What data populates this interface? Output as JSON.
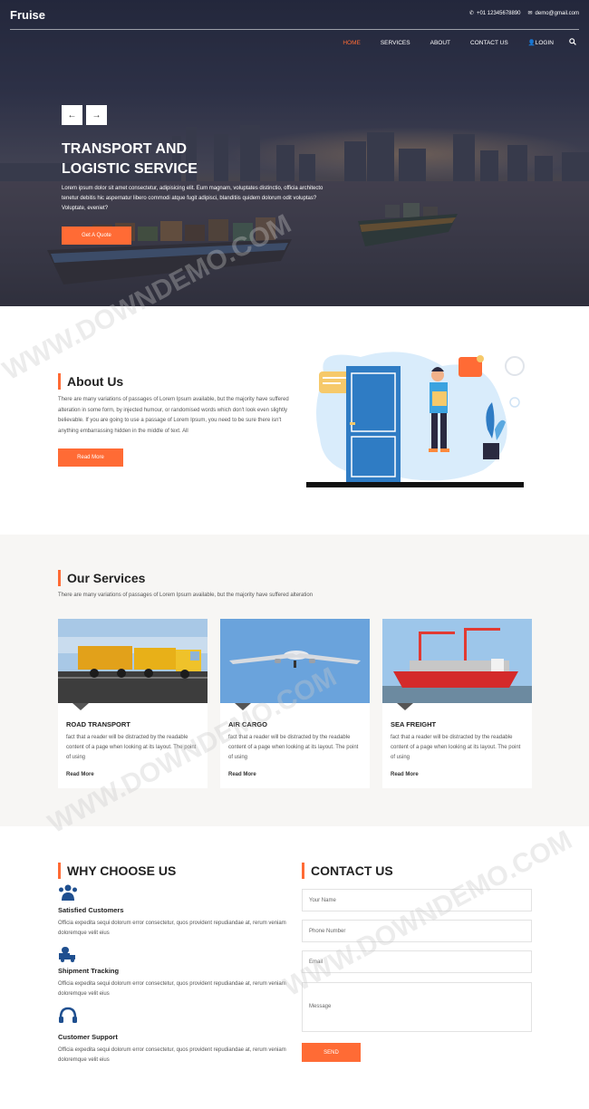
{
  "header": {
    "brand": "Fruise",
    "phone": "+01 12345678890",
    "email": "demo@gmail.com",
    "nav": [
      {
        "label": "HOME",
        "active": true
      },
      {
        "label": "SERVICES",
        "active": false
      },
      {
        "label": "ABOUT",
        "active": false
      },
      {
        "label": "CONTACT US",
        "active": false
      },
      {
        "label": "LOGIN",
        "active": false
      }
    ]
  },
  "hero": {
    "prev_arrow": "←",
    "next_arrow": "→",
    "title_line1": "TRANSPORT AND",
    "title_line2": "LOGISTIC SERVICE",
    "text": "Lorem ipsum dolor sit amet consectetur, adipisicing elit. Eum magnam, voluptates distinctio, officia architecto tenetur debitis hic aspernatur libero commodi atque fugit adipisci, blanditiis quidem dolorum odit voluptas? Voluptate, eveniet?",
    "button": "Get A Quote"
  },
  "about": {
    "title": "About Us",
    "text": "There are many variations of passages of Lorem Ipsum available, but the majority have suffered alteration in some form, by injected humour, or randomised words which don't look even slightly believable. If you are going to use a passage of Lorem Ipsum, you need to be sure there isn't anything embarrassing hidden in the middle of text. All",
    "button": "Read More"
  },
  "services": {
    "title": "Our Services",
    "subtitle": "There are many variations of passages of Lorem Ipsum available, but the majority have suffered alteration",
    "cards": [
      {
        "title": "ROAD TRANSPORT",
        "text": "fact that a reader will be distracted by the readable content of a page when looking at its layout. The point of using",
        "link": "Read More"
      },
      {
        "title": "AIR CARGO",
        "text": "fact that a reader will be distracted by the readable content of a page when looking at its layout. The point of using",
        "link": "Read More"
      },
      {
        "title": "SEA FREIGHT",
        "text": "fact that a reader will be distracted by the readable content of a page when looking at its layout. The point of using",
        "link": "Read More"
      }
    ]
  },
  "why": {
    "title": "WHY CHOOSE US",
    "items": [
      {
        "title": "Satisfied Customers",
        "text": "Officia expedita sequi dolorum error consectetur, quos provident repudiandae at, rerum veniam doloremque velit eius"
      },
      {
        "title": "Shipment Tracking",
        "text": "Officia expedita sequi dolorum error consectetur, quos provident repudiandae at, rerum veniam doloremque velit eius"
      },
      {
        "title": "Customer Support",
        "text": "Officia expedita sequi dolorum error consectetur, quos provident repudiandae at, rerum veniam doloremque velit eius"
      }
    ]
  },
  "contact": {
    "title": "CONTACT US",
    "name_placeholder": "Your Name",
    "phone_placeholder": "Phone Number",
    "email_placeholder": "Email",
    "message_placeholder": "Message",
    "button": "SEND"
  },
  "watermark": "WWW.DOWNDEMO.COM",
  "colors": {
    "accent": "#ff6b35",
    "icon_blue": "#1f4f8f"
  }
}
